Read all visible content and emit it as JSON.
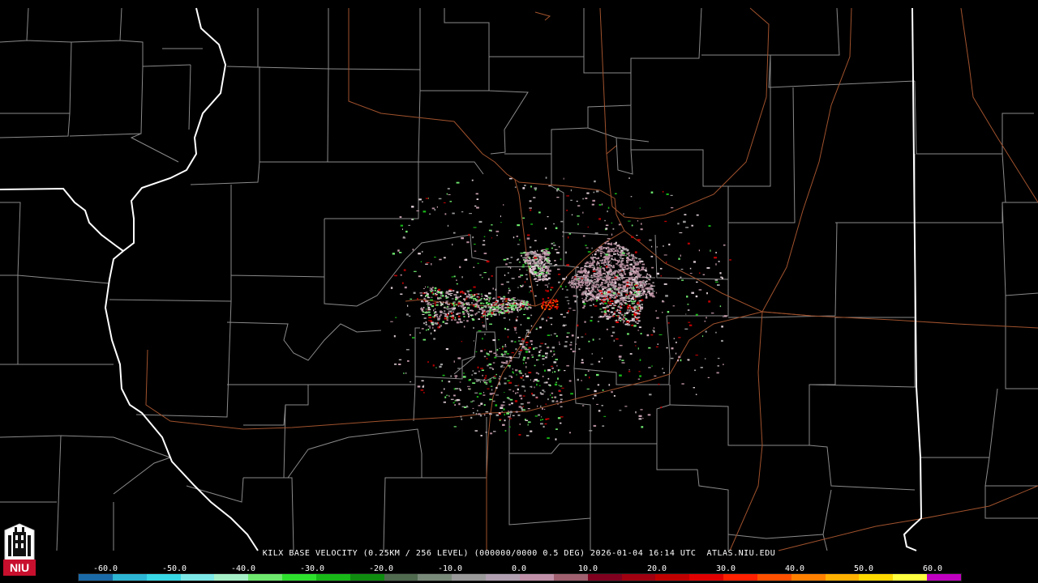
{
  "product": {
    "title": "KILX BASE VELOCITY (0.25KM / 256 LEVEL) (000000/0000 0.5 DEG) 2026-01-04 16:14 UTC  ATLAS.NIU.EDU"
  },
  "logo": {
    "text": "NIU",
    "description_icon": "niu-tower-logo"
  },
  "colors": {
    "background": "#000000",
    "county_lines": "#8a8a8a",
    "state_lines": "#ffffff",
    "highways": "#a0522d"
  },
  "color_scale": {
    "ticks": [
      "-60.0",
      "-50.0",
      "-40.0",
      "-30.0",
      "-20.0",
      "-10.0",
      "0.0",
      "10.0",
      "20.0",
      "30.0",
      "40.0",
      "50.0",
      "60.0"
    ],
    "colors": [
      "#1a6aa8",
      "#2cb5d4",
      "#38d8e6",
      "#7de8e8",
      "#a6f0c8",
      "#6ee86e",
      "#2ee02e",
      "#18b818",
      "#0f8c0f",
      "#506a50",
      "#7a8a7a",
      "#9a9a9a",
      "#b0a0b0",
      "#c090a8",
      "#a06070",
      "#800020",
      "#a00010",
      "#c00000",
      "#e00000",
      "#ff2000",
      "#ff5000",
      "#ff8000",
      "#ffb000",
      "#ffd800",
      "#ffff40",
      "#c000c0"
    ],
    "values": [
      -64,
      64
    ]
  }
}
